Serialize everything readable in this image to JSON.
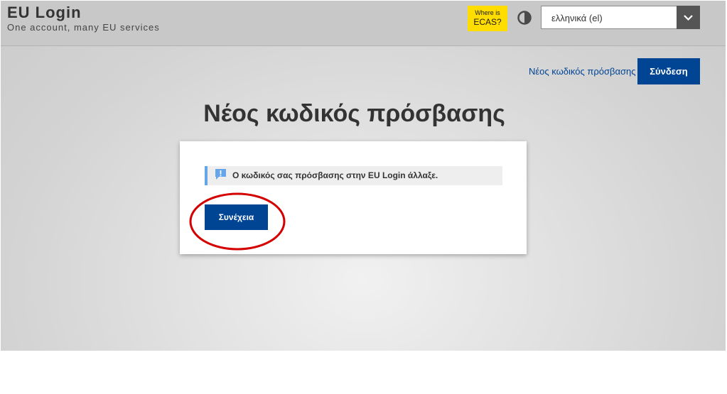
{
  "header": {
    "title": "EU Login",
    "subtitle": "One account, many EU services",
    "ecas": {
      "line1": "Where is",
      "line2": "ECAS?",
      "color": "#ffdd00"
    },
    "contrast_icon": "contrast-icon",
    "language_select": {
      "value": "ελληνικά (el)",
      "arrow_icon": "chevron-down-icon"
    }
  },
  "top_actions": {
    "new_password_link": "Νέος κωδικός πρόσβασης",
    "signin_button": "Σύνδεση"
  },
  "main": {
    "title": "Νέος κωδικός πρόσβασης",
    "notice": {
      "icon": "info-exclamation-icon",
      "text": "Ο κωδικός σας πρόσβασης στην EU Login άλλαξε."
    },
    "continue_button": "Συνέχεια"
  },
  "colors": {
    "primary": "#004494",
    "notice_border": "#64a6e7",
    "highlight_ring": "#d40000"
  }
}
